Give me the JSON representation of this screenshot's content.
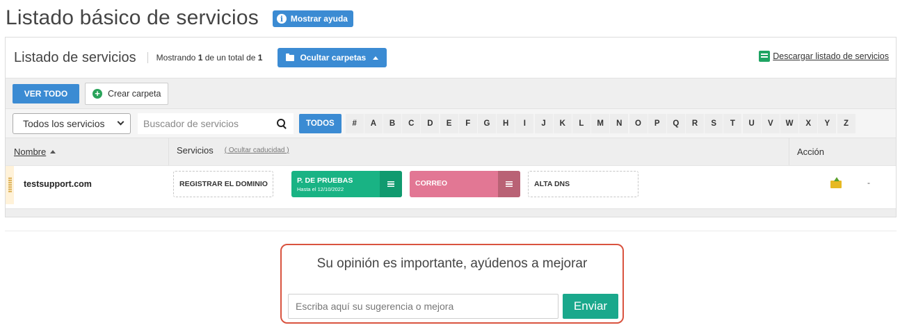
{
  "page": {
    "title": "Listado básico de servicios",
    "help_label": "Mostrar ayuda"
  },
  "panel": {
    "title": "Listado de servicios",
    "showing_prefix": "Mostrando ",
    "showing_count": "1",
    "showing_middle": " de un total de ",
    "showing_total": "1",
    "toggle_folders_label": "Ocultar carpetas",
    "download_label": "Descargar listado de servicios"
  },
  "toolbar": {
    "view_all_label": "VER TODO",
    "create_folder_label": "Crear carpeta"
  },
  "filters": {
    "select_value": "Todos los servicios",
    "search_placeholder": "Buscador de servicios",
    "letters": [
      "TODOS",
      "#",
      "A",
      "B",
      "C",
      "D",
      "E",
      "F",
      "G",
      "H",
      "I",
      "J",
      "K",
      "L",
      "M",
      "N",
      "O",
      "P",
      "Q",
      "R",
      "S",
      "T",
      "U",
      "V",
      "W",
      "X",
      "Y",
      "Z"
    ]
  },
  "table": {
    "col_name": "Nombre",
    "col_services": "Servicios",
    "hide_expiry_label": "( Ocultar caducidad )",
    "col_action": "Acción",
    "rows": [
      {
        "domain": "testsupport.com",
        "services": [
          {
            "label": "REGISTRAR EL DOMINIO"
          },
          {
            "label": "P. DE PRUEBAS",
            "sub": "Hasta el 12/10/2022",
            "color": "#19b384",
            "menu_color": "#119a6f"
          },
          {
            "label": "CORREO",
            "color": "#e27794",
            "menu_color": "#b96275"
          },
          {
            "label": "ALTA DNS"
          }
        ],
        "action_icon": "folder-move-icon",
        "extra": "-"
      }
    ]
  },
  "feedback": {
    "question": "Su opinión es importante, ayúdenos a mejorar",
    "placeholder": "Escriba aquí su sugerencia o mejora",
    "send_label": "Enviar"
  },
  "colors": {
    "primary": "#3b8bd3",
    "teal": "#1aa88c",
    "alert_border": "#d9533f"
  }
}
